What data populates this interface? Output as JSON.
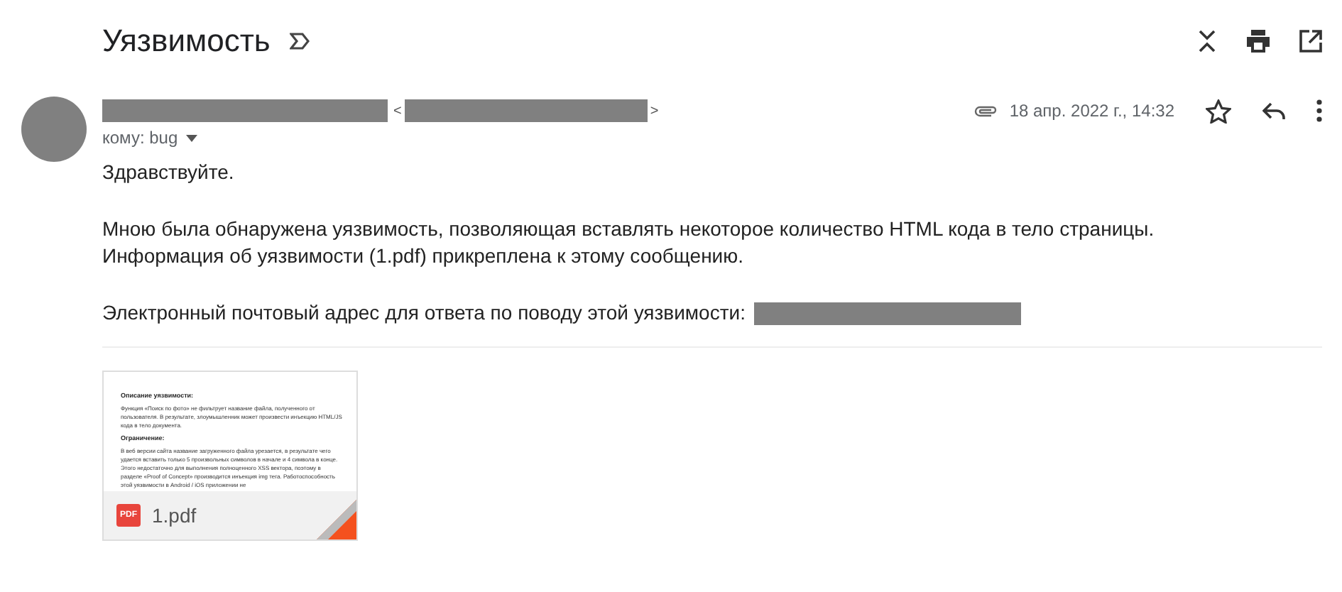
{
  "subject": "Уязвимость",
  "sender": {
    "open_bracket": "<",
    "close_bracket": ">",
    "recipient": "кому: bug",
    "date": "18 апр. 2022 г., 14:32"
  },
  "body": {
    "greeting": "Здравствуйте.",
    "paragraph": [
      "Мною была обнаружена уязвимость, позволяющая вставлять некоторое количество HTML кода в тело страницы.",
      "Информация об уязвимости (1.pdf) прикреплена к этому сообщению."
    ],
    "contact": "Электронный почтовый адрес для ответа по поводу этой уязвимости:"
  },
  "attachment": {
    "name": "1.pdf",
    "type_badge": "PDF",
    "preview": [
      {
        "kind": "heading",
        "text": "Описание уязвимости:"
      },
      {
        "kind": "text",
        "text": "Функция «Поиск по фото» не фильтрует название файла, полученного от пользователя. В результате, злоумышленник может произвести инъекцию HTML/JS кода в тело документа."
      },
      {
        "kind": "heading",
        "text": "Ограничение:"
      },
      {
        "kind": "text",
        "text": "В веб версии сайта название загруженного файла урезается, в результате чего удается вставить только 5 произвольных символов в начале и 4 символа в конце. Этого недостаточно для выполнения полноценного XSS вектора, поэтому в разделе «Proof of Concept» производится инъекция img тега. Работоспособность этой уязвимости в Android / iOS приложении не"
      }
    ]
  }
}
